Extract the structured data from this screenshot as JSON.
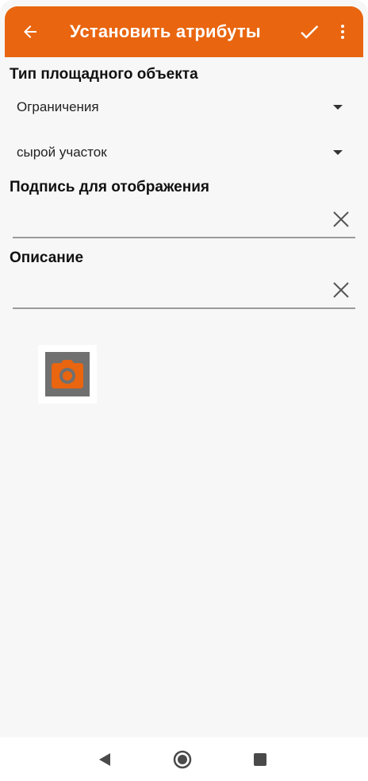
{
  "appbar": {
    "title": "Установить атрибуты",
    "icons": [
      "back-arrow-icon",
      "check-icon",
      "more-vert-icon"
    ],
    "color": "#e9650f"
  },
  "form": {
    "type_label": "Тип площадного объекта",
    "category_value": "Ограничения",
    "subtype_value": "сырой участок",
    "caption_label": "Подпись для отображения",
    "caption_value": "",
    "description_label": "Описание",
    "description_value": ""
  },
  "photo": {
    "icon": "camera-icon",
    "accent": "#e9650f"
  },
  "navbar": {
    "icons": [
      "nav-back-icon",
      "nav-home-icon",
      "nav-recent-icon"
    ]
  }
}
